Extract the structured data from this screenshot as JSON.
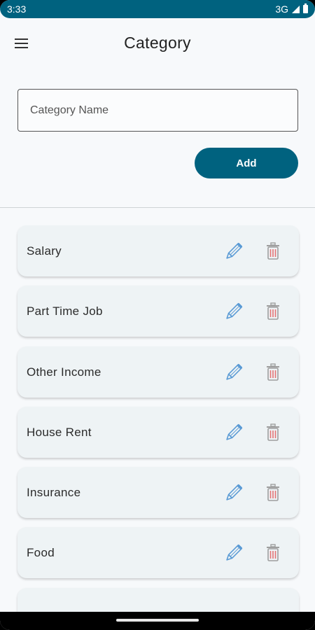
{
  "status_bar": {
    "time": "3:33",
    "network": "3G"
  },
  "header": {
    "title": "Category",
    "menu_icon": "menu-icon"
  },
  "form": {
    "name_placeholder": "Category Name",
    "name_value": "",
    "add_label": "Add"
  },
  "categories": [
    {
      "label": "Salary"
    },
    {
      "label": "Part Time Job"
    },
    {
      "label": "Other Income"
    },
    {
      "label": "House Rent"
    },
    {
      "label": "Insurance"
    },
    {
      "label": "Food"
    }
  ],
  "icons": {
    "edit": "pencil-icon",
    "delete": "trash-icon"
  },
  "colors": {
    "primary": "#00627f",
    "edit_icon": "#5b9bd5",
    "delete_icon": "#e57373",
    "card": "#eef3f5"
  }
}
